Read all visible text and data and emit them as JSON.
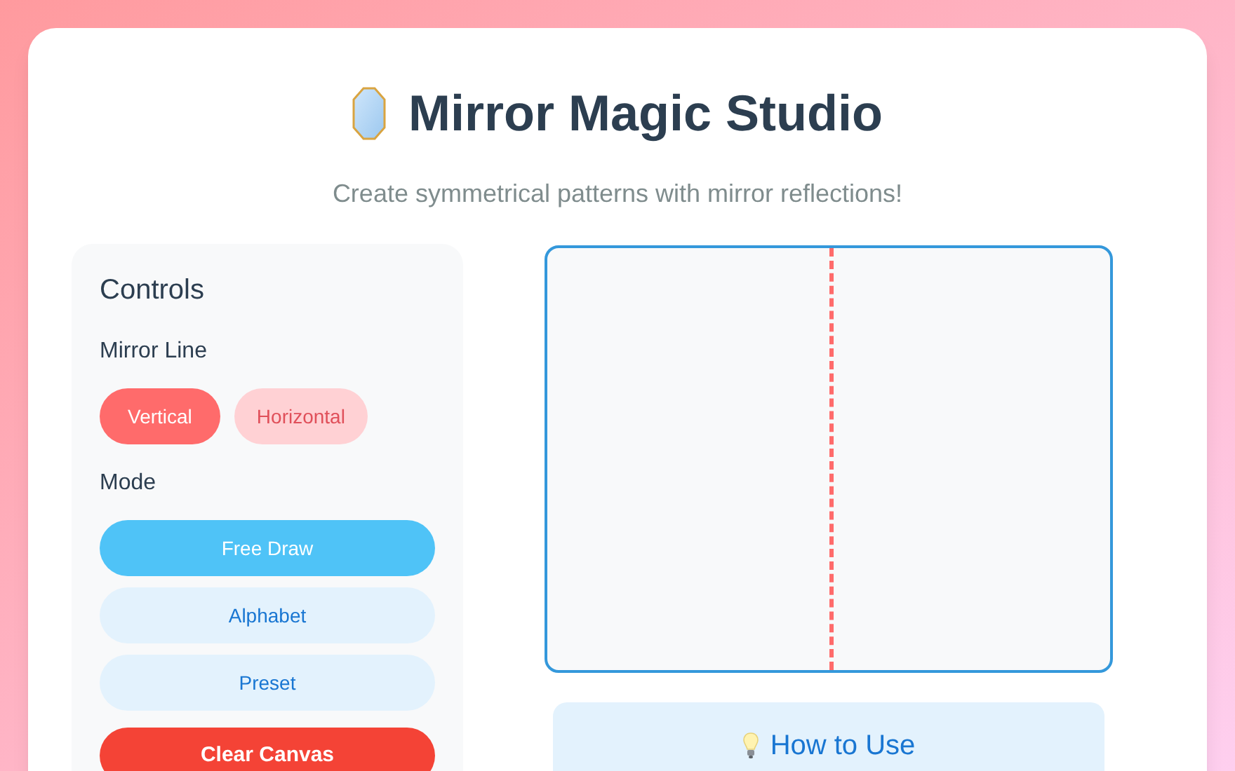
{
  "header": {
    "title": "Mirror Magic Studio",
    "subtitle": "Create symmetrical patterns with mirror reflections!"
  },
  "controls": {
    "title": "Controls",
    "mirror_line_label": "Mirror Line",
    "mirror_lines": [
      {
        "label": "Vertical",
        "selected": true
      },
      {
        "label": "Horizontal",
        "selected": false
      }
    ],
    "mode_label": "Mode",
    "modes": [
      {
        "label": "Free Draw",
        "selected": true
      },
      {
        "label": "Alphabet",
        "selected": false
      },
      {
        "label": "Preset",
        "selected": false
      }
    ],
    "clear_button": "Clear Canvas"
  },
  "canvas": {
    "mirror_vertical": true
  },
  "help": {
    "title": "How to Use"
  }
}
